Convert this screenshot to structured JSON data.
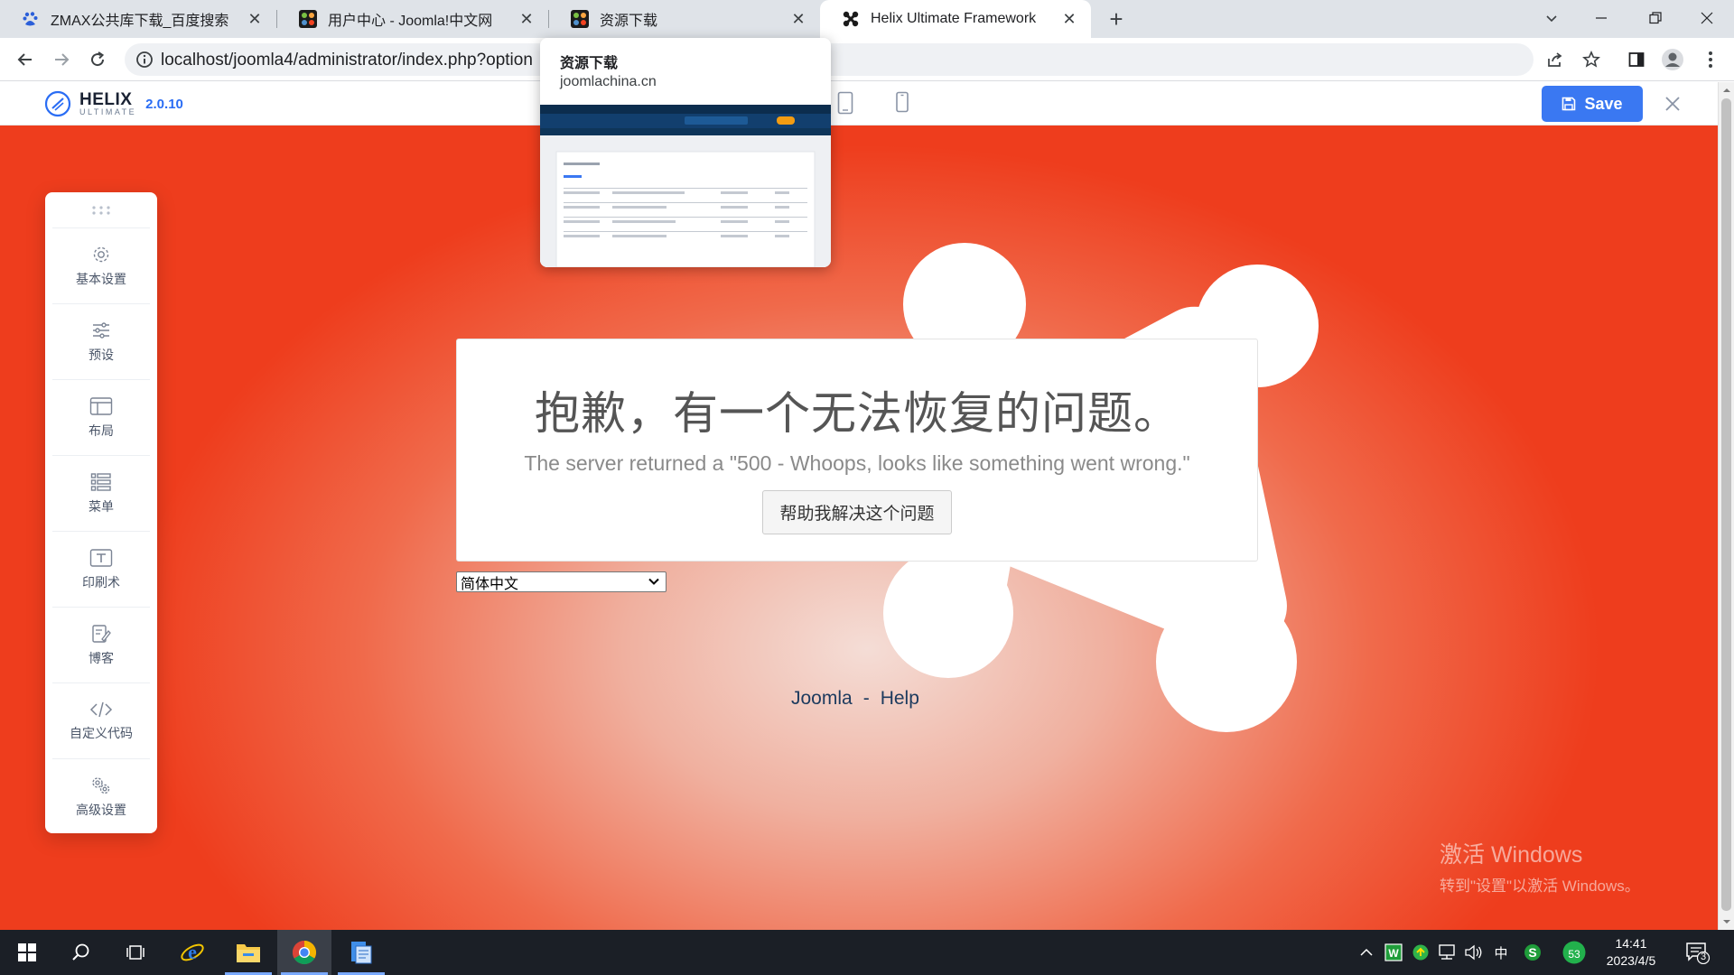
{
  "browser": {
    "tabs": [
      {
        "title": "ZMAX公共库下载_百度搜索",
        "icon": "baidu-paw-icon",
        "active": false
      },
      {
        "title": "用户中心 - Joomla!中文网",
        "icon": "joomla-icon",
        "active": false
      },
      {
        "title": "资源下载",
        "icon": "joomla-icon",
        "active": false
      },
      {
        "title": "Helix Ultimate Framework",
        "icon": "joomla-icon",
        "active": true
      }
    ],
    "url": "localhost/joomla4/administrator/index.php?option",
    "hover_card": {
      "title": "资源下载",
      "domain": "joomlachina.cn"
    }
  },
  "helix": {
    "brand": "HELIX",
    "brand_sub": "ULTIMATE",
    "version": "2.0.10",
    "save_label": "Save",
    "accent": "#3a78f2"
  },
  "sidebar": {
    "items": [
      {
        "label": "基本设置",
        "icon": "gear-icon"
      },
      {
        "label": "预设",
        "icon": "sliders-icon"
      },
      {
        "label": "布局",
        "icon": "layout-icon"
      },
      {
        "label": "菜单",
        "icon": "menu-list-icon"
      },
      {
        "label": "印刷术",
        "icon": "typography-icon"
      },
      {
        "label": "博客",
        "icon": "blog-edit-icon"
      },
      {
        "label": "自定义代码",
        "icon": "code-icon"
      },
      {
        "label": "高级设置",
        "icon": "advanced-cogs-icon"
      }
    ]
  },
  "error": {
    "title": "抱歉，有一个无法恢复的问题。",
    "message": "The server returned a \"500 - Whoops, looks like something went wrong.\"",
    "help_button": "帮助我解决这个问题",
    "language": "简体中文"
  },
  "footer": {
    "link1": "Joomla",
    "separator": "-",
    "link2": "Help"
  },
  "watermark": {
    "line1": "激活 Windows",
    "line2": "转到\"设置\"以激活 Windows。"
  },
  "taskbar": {
    "time": "14:41",
    "date": "2023/4/5",
    "ime": "中",
    "badge_number": "53",
    "notification_count": "3"
  },
  "colors": {
    "preview_red": "#ee3d1d",
    "taskbar_bg": "#1b1f26"
  }
}
